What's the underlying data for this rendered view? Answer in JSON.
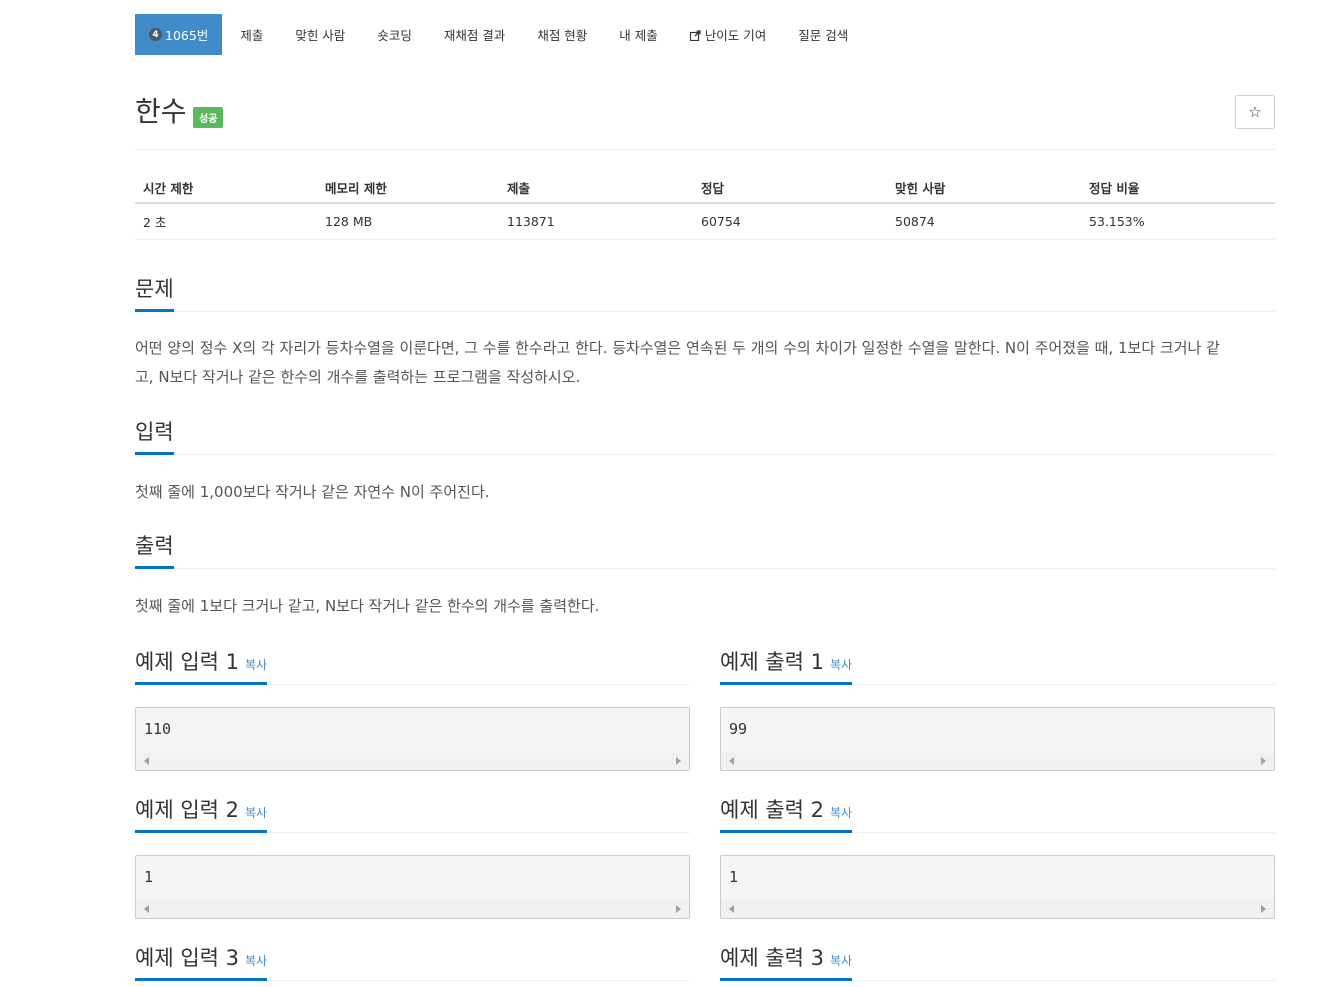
{
  "nav": {
    "problem_tier": "4",
    "problem_id": "1065번",
    "items": [
      "제출",
      "맞힌 사람",
      "숏코딩",
      "재채점 결과",
      "채점 현황",
      "내 제출",
      "난이도 기여",
      "질문 검색"
    ]
  },
  "problem": {
    "title": "한수",
    "badge": "성공",
    "star": "☆"
  },
  "info": {
    "headers": [
      "시간 제한",
      "메모리 제한",
      "제출",
      "정답",
      "맞힌 사람",
      "정답 비율"
    ],
    "values": [
      "2 초",
      "128 MB",
      "113871",
      "60754",
      "50874",
      "53.153%"
    ]
  },
  "sections": {
    "description": {
      "heading": "문제",
      "line1": "어떤 양의 정수 X의 각 자리가 등차수열을 이룬다면, 그 수를 한수라고 한다. 등차수열은 연속된 두 개의 수의 차이가 일정한 수열을 말한다. N이 주어졌을 때, 1보다 크거나 같",
      "line2": "고, N보다 작거나 같은 한수의 개수를 출력하는 프로그램을 작성하시오."
    },
    "input": {
      "heading": "입력",
      "text": "첫째 줄에 1,000보다 작거나 같은 자연수 N이 주어진다."
    },
    "output": {
      "heading": "출력",
      "text": "첫째 줄에 1보다 크거나 같고, N보다 작거나 같은 한수의 개수를 출력한다."
    }
  },
  "samples": {
    "copy_label": "복사",
    "items": [
      {
        "input_heading": "예제 입력 1",
        "input": "110",
        "output_heading": "예제 출력 1",
        "output": "99"
      },
      {
        "input_heading": "예제 입력 2",
        "input": "1",
        "output_heading": "예제 출력 2",
        "output": "1"
      },
      {
        "input_heading": "예제 입력 3",
        "output_heading": "예제 출력 3"
      }
    ]
  }
}
